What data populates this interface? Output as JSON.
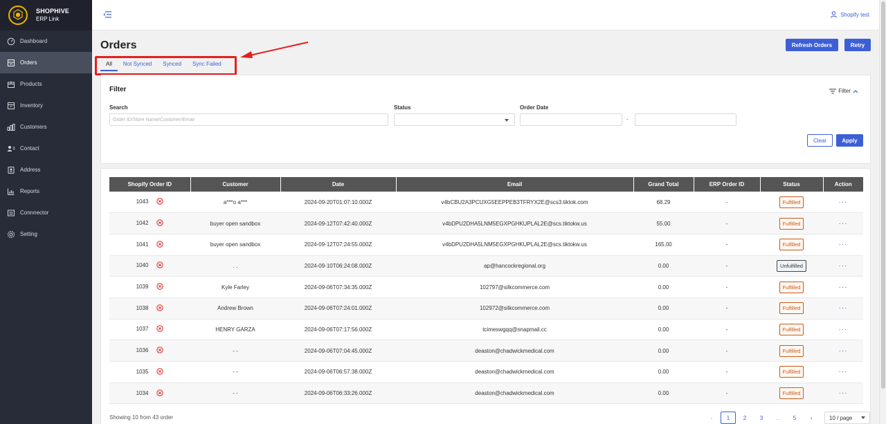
{
  "brand": {
    "name": "SHOPHIVE",
    "sub": "ERP Link"
  },
  "sidebar": {
    "items": [
      {
        "label": "Dashboard",
        "icon": "dashboard-icon"
      },
      {
        "label": "Orders",
        "icon": "orders-icon",
        "active": true
      },
      {
        "label": "Products",
        "icon": "products-icon"
      },
      {
        "label": "Inventory",
        "icon": "inventory-icon"
      },
      {
        "label": "Customers",
        "icon": "customers-icon"
      },
      {
        "label": "Contact",
        "icon": "contact-icon"
      },
      {
        "label": "Address",
        "icon": "address-icon"
      },
      {
        "label": "Reports",
        "icon": "reports-icon"
      },
      {
        "label": "Connnector",
        "icon": "connector-icon"
      },
      {
        "label": "Setting",
        "icon": "gear-icon"
      }
    ]
  },
  "topbar": {
    "user_label": "Shopify test"
  },
  "page": {
    "title": "Orders",
    "refresh_label": "Refresh Orders",
    "retry_label": "Retry"
  },
  "tabs": [
    "All",
    "Not Synced",
    "Synced",
    "Sync Failed"
  ],
  "filter": {
    "title": "Filter",
    "toggle_label": "Filter",
    "search_label": "Search",
    "search_placeholder": "Order ID/Store Name/Customer/Email",
    "status_label": "Status",
    "date_label": "Order Date",
    "date_separator": "-",
    "clear_label": "Clear",
    "apply_label": "Apply"
  },
  "table": {
    "headers": [
      "Shopify Order ID",
      "Customer",
      "Date",
      "Email",
      "Grand Total",
      "ERP Order ID",
      "Status",
      "Action"
    ],
    "rows": [
      {
        "id": "1043",
        "customer": "a***o a***",
        "date": "2024-09-20T01:07:10.000Z",
        "email": "v4bCBU2A3PCUXG5EEPPEB3TFRYX2E@scs3.tiktok.com",
        "total": "68.29",
        "erp": "-",
        "status": "Fulfilled"
      },
      {
        "id": "1042",
        "customer": "buyer open sandbox",
        "date": "2024-09-12T07:42:40.000Z",
        "email": "v4bDPU2DHA5LNM5EGXPGHKUPLAL2E@scs.tiktokw.us",
        "total": "55.00",
        "erp": "-",
        "status": "Fulfilled"
      },
      {
        "id": "1041",
        "customer": "buyer open sandbox",
        "date": "2024-09-12T07:24:55.000Z",
        "email": "v4bDPU2DHA5LNM5EGXPGHKUPLAL2E@scs.tiktokw.us",
        "total": "165.00",
        "erp": "-",
        "status": "Fulfilled"
      },
      {
        "id": "1040",
        "customer": ". .",
        "date": "2024-09-10T06:24:08.000Z",
        "email": "ap@hancockregional.org",
        "total": "0.00",
        "erp": "-",
        "status": "Unfulfilled"
      },
      {
        "id": "1039",
        "customer": "Kyle Farley",
        "date": "2024-09-06T07:34:35.000Z",
        "email": "102797@silkcommerce.com",
        "total": "0.00",
        "erp": "-",
        "status": "Fulfilled"
      },
      {
        "id": "1038",
        "customer": "Andrew Brown",
        "date": "2024-09-06T07:24:01.000Z",
        "email": "102972@silkcommerce.com",
        "total": "0.00",
        "erp": "-",
        "status": "Fulfilled"
      },
      {
        "id": "1037",
        "customer": "HENRY GARZA",
        "date": "2024-09-06T07:17:56.000Z",
        "email": "tcimeswgqq@snapmail.cc",
        "total": "0.00",
        "erp": "-",
        "status": "Fulfilled"
      },
      {
        "id": "1036",
        "customer": "- -",
        "date": "2024-09-06T07:04:45.000Z",
        "email": "deaston@chadwickmedical.com",
        "total": "0.00",
        "erp": "-",
        "status": "Fulfilled"
      },
      {
        "id": "1035",
        "customer": "- -",
        "date": "2024-09-06T06:57:38.000Z",
        "email": "deaston@chadwickmedical.com",
        "total": "0.00",
        "erp": "-",
        "status": "Fulfilled"
      },
      {
        "id": "1034",
        "customer": "- -",
        "date": "2024-09-06T06:33:26.000Z",
        "email": "deaston@chadwickmedical.com",
        "total": "0.00",
        "erp": "-",
        "status": "Fulfilled"
      }
    ],
    "action_glyph": "···"
  },
  "footer": {
    "count_text": "Showing 10 from 43 order",
    "pages": [
      "1",
      "2",
      "3",
      "...",
      "5"
    ],
    "current_page": "1",
    "prev": "‹",
    "next": "›",
    "page_size": "10 / page"
  },
  "colors": {
    "accent": "#3d5fd6",
    "sidebar": "#282c38",
    "highlight": "#e61e1e",
    "fulfilled": "#c55a1c",
    "error": "#e02020"
  }
}
